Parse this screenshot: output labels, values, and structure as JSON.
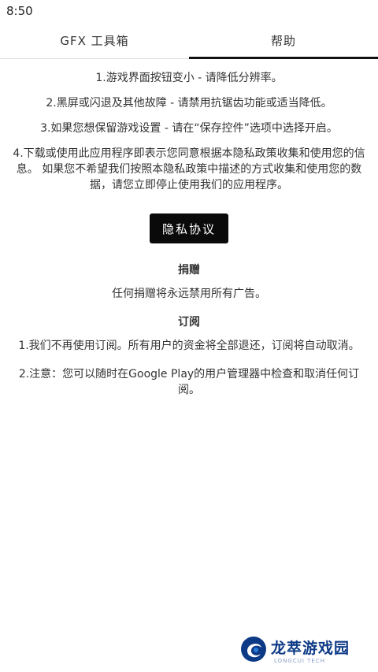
{
  "status_bar": {
    "time": "8:50"
  },
  "tabs": [
    {
      "label": "GFX 工具箱",
      "active": false
    },
    {
      "label": "帮助",
      "active": true
    }
  ],
  "help": {
    "item1": "1.游戏界面按钮变小 - 请降低分辨率。",
    "item2": "2.黑屏或闪退及其他故障 - 请禁用抗锯齿功能或适当降低。",
    "item3": "3.如果您想保留游戏设置 - 请在“保存控件”选项中选择开启。",
    "item4": "4.下载或使用此应用程序即表示您同意根据本隐私政策收集和使用您的信息。 如果您不希望我们按照本隐私政策中描述的方式收集和使用您的数据，请您立即停止使用我们的应用程序。"
  },
  "privacy_button": "隐私协议",
  "donate": {
    "title": "捐赠",
    "text": "任何捐赠将永远禁用所有广告。"
  },
  "subscription": {
    "title": "订阅",
    "item1": "1.我们不再使用订阅。所有用户的资金将全部退还，订阅将自动取消。",
    "item2": "2.注意：您可以随时在Google Play的用户管理器中检查和取消任何订阅。"
  },
  "watermark": {
    "title": "龙萃游戏园",
    "subtitle": "LONGCUI TECH",
    "icon": "longcui-logo"
  },
  "colors": {
    "button_bg": "#0a0a0a",
    "tab_indicator": "#111111",
    "watermark": "#0d3a86"
  }
}
